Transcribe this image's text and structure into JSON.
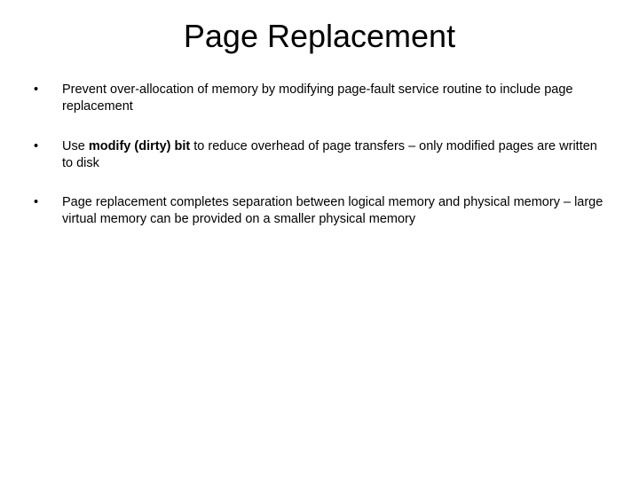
{
  "slide": {
    "title": "Page Replacement",
    "bullets": [
      {
        "glyph": "•",
        "pre": "Prevent over-allocation of memory by modifying page-fault service routine to include page replacement",
        "bold": "",
        "post": ""
      },
      {
        "glyph": "•",
        "pre": "Use ",
        "bold": "modify (dirty) bit",
        "post": " to reduce overhead of page transfers – only modified pages are written to disk"
      },
      {
        "glyph": "•",
        "pre": "Page replacement completes separation between logical memory and physical memory – large virtual memory can be provided on a smaller physical memory",
        "bold": "",
        "post": ""
      }
    ]
  }
}
